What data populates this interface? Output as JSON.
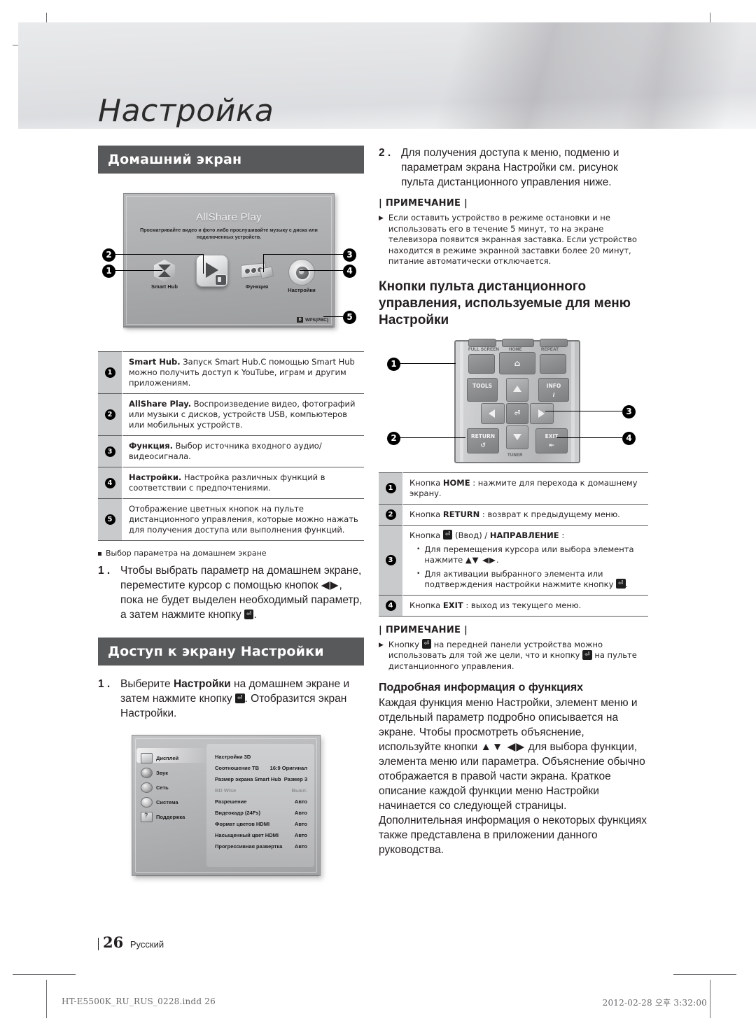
{
  "document": {
    "chapter_title": "Настройка",
    "page_number": "26",
    "language_label": "Русский",
    "print_file": "HT-E5500K_RU_RUS_0228.indd   26",
    "print_timestamp": "2012-02-28   오후 3:32:00"
  },
  "left_column": {
    "section_title": "Домашний экран",
    "home_screen": {
      "title": "AllShare Play",
      "subtitle": "Просматривайте видео и фото либо прослушивайте музыку с диска или подключенных устройств.",
      "icons": [
        {
          "label": "Smart Hub",
          "icon": "cube-icon"
        },
        {
          "label": "",
          "icon": "allshare-play-icon"
        },
        {
          "label": "Функция",
          "icon": "function-icon"
        },
        {
          "label": "Настройки",
          "icon": "gear-icon"
        }
      ],
      "wps_badge_key": "D",
      "wps_badge_text": "WPS(PBC)",
      "callouts": [
        "1",
        "2",
        "3",
        "4",
        "5"
      ]
    },
    "legend_rows": [
      {
        "num": "1",
        "bold": "Smart Hub.",
        "text": " Запуск Smart Hub.С помощью Smart Hub можно получить доступ к YouTube, играм и другим приложениям."
      },
      {
        "num": "2",
        "bold": "AllShare Play.",
        "text": " Воспроизведение видео, фотографий или музыки с дисков, устройств USB, компьютеров или мобильных устройств."
      },
      {
        "num": "3",
        "bold": "Функция.",
        "text": " Выбор источника входного аудио/видеосигнала."
      },
      {
        "num": "4",
        "bold": "Настройки.",
        "text": " Настройка различных функций в соответствии с предпочтениями."
      },
      {
        "num": "5",
        "bold": "",
        "text": "Отображение цветных кнопок на пульте дистанционного управления, которые можно нажать для получения доступа или выполнения функций."
      }
    ],
    "sub_bullet": "Выбор параметра на домашнем экране",
    "step1": {
      "number": "1 .",
      "part1": "Чтобы выбрать параметр на домашнем экране, переместите курсор с помощью кнопок ",
      "arrows": "◀▶",
      "part2": ", пока не будет выделен необходимый параметр, а затем нажмите кнопку ",
      "key": "⏎",
      "part3": "."
    },
    "section_title_2": "Доступ к экрану Настройки",
    "step2": {
      "number": "1 .",
      "part1": "Выберите ",
      "bold": "Настройки",
      "part2": " на домашнем экране и затем нажмите кнопку ",
      "key": "⏎",
      "part3": ". Отобразится экран Настройки."
    },
    "settings_screen": {
      "menu_items": [
        {
          "label": "Дисплей",
          "icon": "display-icon",
          "selected": true
        },
        {
          "label": "Звук",
          "icon": "sound-icon",
          "selected": false
        },
        {
          "label": "Сеть",
          "icon": "network-icon",
          "selected": false
        },
        {
          "label": "Система",
          "icon": "system-icon",
          "selected": false
        },
        {
          "label": "Поддержка",
          "icon": "support-icon",
          "selected": false
        }
      ],
      "options": [
        {
          "name": "Настройки 3D",
          "value": "",
          "disabled": false
        },
        {
          "name": "Соотношение ТВ",
          "value": "16:9 Оригинал",
          "disabled": false
        },
        {
          "name": "Размер экрана Smart Hub",
          "value": "Размер 3",
          "disabled": false
        },
        {
          "name": "BD Wise",
          "value": "Выкл.",
          "disabled": true
        },
        {
          "name": "Разрешение",
          "value": "Авто",
          "disabled": false
        },
        {
          "name": "Видеокадр (24Fs)",
          "value": "Авто",
          "disabled": false
        },
        {
          "name": "Формат цветов HDMI",
          "value": "Авто",
          "disabled": false
        },
        {
          "name": "Насыщенный цвет HDMI",
          "value": "Авто",
          "disabled": false
        },
        {
          "name": "Прогрессивная развертка",
          "value": "Авто",
          "disabled": false
        }
      ]
    }
  },
  "right_column": {
    "step2": {
      "number": "2 .",
      "text": "Для получения доступа к меню, подменю и параметрам экрана Настройки см. рисунок пульта дистанционного управления ниже."
    },
    "note1": {
      "heading": "| ПРИМЕЧАНИЕ |",
      "items": [
        "Если оставить устройство в режиме остановки и не использовать его в течение 5 минут, то на экране телевизора появится экранная заставка. Если устройство находится в режиме экранной заставки более 20 минут, питание автоматически отключается."
      ]
    },
    "heading_remote": "Кнопки пульта дистанционного управления, используемые для меню Настройки",
    "remote": {
      "labels_top": [
        "FULL SCREEN",
        "HOME",
        "REPEAT"
      ],
      "keys": [
        "TOOLS",
        "INFO",
        "RETURN",
        "EXIT"
      ],
      "label_bottom": "TUNER",
      "callouts": [
        "1",
        "2",
        "3",
        "4"
      ]
    },
    "remote_rows": [
      {
        "num": "1",
        "pre": "Кнопка ",
        "bold": "HOME",
        "post": " : нажмите для перехода к домашнему экрану."
      },
      {
        "num": "2",
        "pre": "Кнопка ",
        "bold": "RETURN",
        "post": " : возврат к предыдущему меню."
      },
      {
        "num": "3",
        "pre": "Кнопка ",
        "key": "⏎",
        "mid": " (Ввод) / ",
        "bold": "НАПРАВЛЕНИЕ",
        "post": " :",
        "bullets": [
          {
            "text_a": "Для перемещения курсора или выбора элемента нажмите ",
            "arrows": "▲▼ ◀▶",
            "text_b": "."
          },
          {
            "text_a": "Для активации выбранного элемента или подтверждения настройки нажмите кнопку ",
            "key": "⏎",
            "text_b": "."
          }
        ]
      },
      {
        "num": "4",
        "pre": "Кнопка ",
        "bold": "EXIT",
        "post": " : выход из текущего меню."
      }
    ],
    "note2": {
      "heading": "| ПРИМЕЧАНИЕ |",
      "item_a": "Кнопку ",
      "item_key1": "⏎",
      "item_b": " на передней панели устройства можно использовать для той же цели, что и кнопку ",
      "item_key2": "⏎",
      "item_c": " на пульте дистанционного управления."
    },
    "details_heading": "Подробная информация о функциях",
    "details_text_a": "Каждая функция меню Настройки, элемент меню и отдельный параметр подробно описывается на экране. Чтобы просмотреть объяснение, используйте кнопки ",
    "details_arrows": "▲▼ ◀▶",
    "details_text_b": " для выбора функции, элемента меню или параметра. Объяснение обычно отображается в правой части экрана. Краткое описание каждой функции меню Настройки начинается со следующей страницы. Дополнительная информация о некоторых функциях также представлена в приложении данного руководства."
  },
  "colors": {
    "section_bar": "#58595b",
    "num_cell": "#c9cacb",
    "text": "#231f20"
  }
}
